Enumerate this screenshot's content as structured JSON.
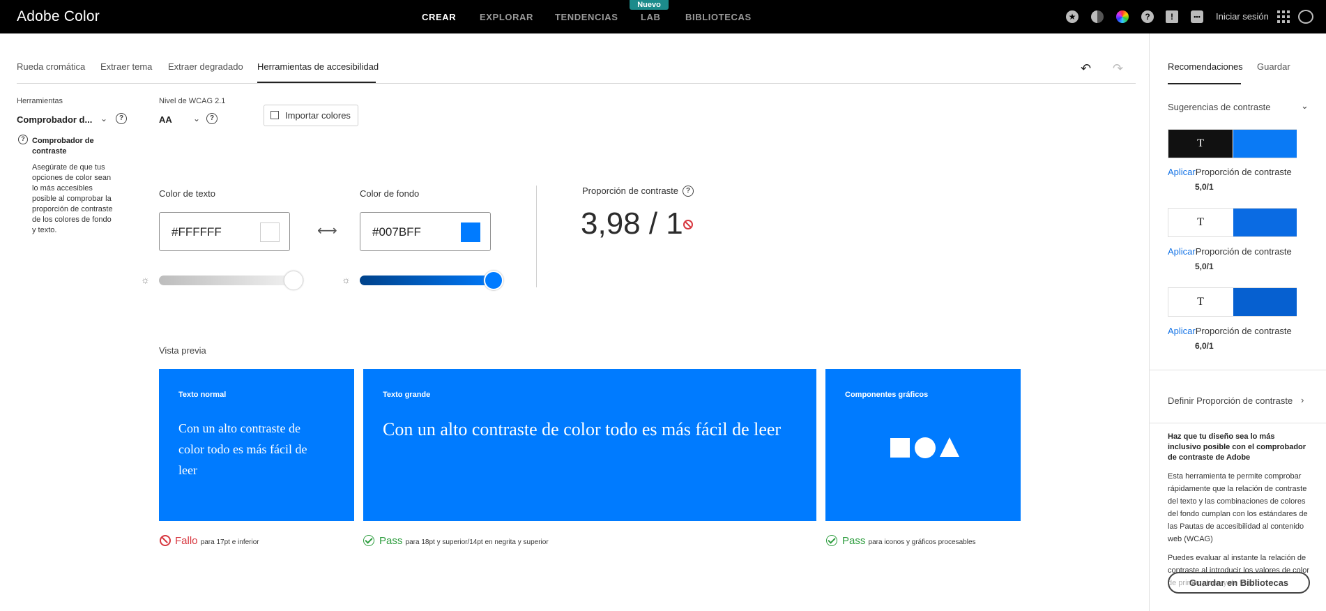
{
  "app": {
    "brand": "Adobe Color"
  },
  "topnav": {
    "items": [
      "CREAR",
      "EXPLORAR",
      "TENDENCIAS",
      "LAB",
      "BIBLIOTECAS"
    ],
    "active": "CREAR",
    "new_badge": "Nuevo",
    "signin": "Iniciar sesión",
    "icons": [
      "star-icon",
      "halftone-icon",
      "color-wheel-icon",
      "help-icon",
      "alert-icon",
      "feedback-icon",
      "apps-grid-icon",
      "creative-cloud-icon"
    ]
  },
  "tabs": {
    "items": [
      "Rueda cromática",
      "Extraer tema",
      "Extraer degradado",
      "Herramientas de accesibilidad"
    ],
    "active": "Herramientas de accesibilidad"
  },
  "tools": {
    "label": "Herramientas",
    "selected": "Comprobador d...",
    "wcag_label": "Nivel de WCAG 2.1",
    "wcag_selected": "AA",
    "import_label": "Importar colores"
  },
  "info": {
    "title": "Comprobador de contraste",
    "text": "Asegúrate de que tus opciones de color sean lo más accesibles posible al comprobar la proporción de contraste de los colores de fondo y texto."
  },
  "text_color": {
    "label": "Color de texto",
    "hex": "#FFFFFF",
    "swatch": "#FFFFFF",
    "slider_value": 1.0
  },
  "bg_color": {
    "label": "Color de fondo",
    "hex": "#007BFF",
    "swatch": "#007BFF",
    "slider_value": 1.0
  },
  "contrast": {
    "label": "Proporción de contraste",
    "value": "3,98 / 1"
  },
  "preview": {
    "label": "Vista previa",
    "cards": [
      {
        "title": "Texto normal",
        "body": "Con un alto contraste de color todo es más fácil de leer"
      },
      {
        "title": "Texto grande",
        "body": "Con un alto contraste de color todo es más fácil de leer"
      },
      {
        "title": "Componentes gráficos"
      }
    ],
    "results": [
      {
        "status": "Fallo",
        "desc": "para 17pt e inferior",
        "color": "#d7373f"
      },
      {
        "status": "Pass",
        "desc": "para 18pt y superior/14pt en negrita y superior",
        "color": "#2d9d3e"
      },
      {
        "status": "Pass",
        "desc": "para iconos y gráficos procesables",
        "color": "#2d9d3e"
      }
    ]
  },
  "right_panel": {
    "tabs": [
      "Recomendaciones",
      "Guardar"
    ],
    "suggestions_header": "Sugerencias de contraste",
    "suggestions": [
      {
        "text_bg": "#111111",
        "text_color": "#FFFFFF",
        "swatch": "#0a7af5",
        "apply": "Aplicar",
        "ratio_label": "Proporción de contraste",
        "ratio": "5,0/1"
      },
      {
        "text_bg": "#FFFFFF",
        "text_color": "#111111",
        "swatch": "#0a6be3",
        "apply": "Aplicar",
        "ratio_label": "Proporción de contraste",
        "ratio": "5,0/1"
      },
      {
        "text_bg": "#FFFFFF",
        "text_color": "#111111",
        "swatch": "#0660d0",
        "apply": "Aplicar",
        "ratio_label": "Proporción de contraste",
        "ratio": "6,0/1"
      }
    ],
    "define_ratio": "Definir Proporción de contraste",
    "promo_title": "Haz que tu diseño sea lo más inclusivo posible con el comprobador de contraste de Adobe",
    "promo_text1": "Esta herramienta te permite comprobar rápidamente que la relación de contraste del texto y las combinaciones de colores del fondo cumplan con los estándares de las Pautas de accesibilidad al contenido web (WCAG)",
    "promo_text2": "Puedes evaluar al instante la relación de contraste al introducir los valores de color de primer plano y de fondo.",
    "save_button": "Guardar en Bibliotecas"
  }
}
